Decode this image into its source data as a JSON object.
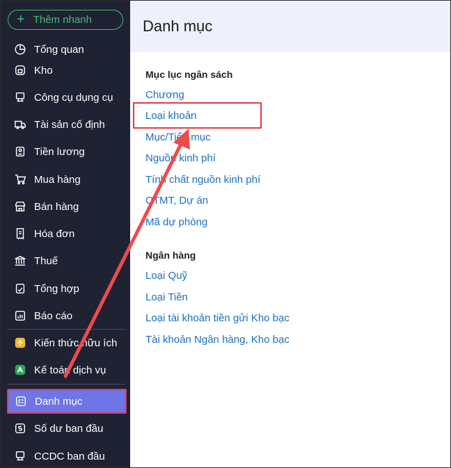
{
  "sidebar": {
    "quick_add_label": "Thêm nhanh",
    "items": [
      {
        "label": "Tổng quan",
        "icon": "pie-chart-icon"
      },
      {
        "label": "Kho",
        "icon": "warehouse-icon"
      },
      {
        "label": "Công cụ dụng cụ",
        "icon": "tools-icon"
      },
      {
        "label": "Tài sản cố định",
        "icon": "truck-icon"
      },
      {
        "label": "Tiền lương",
        "icon": "salary-icon"
      },
      {
        "label": "Mua hàng",
        "icon": "cart-icon"
      },
      {
        "label": "Bán hàng",
        "icon": "store-icon"
      },
      {
        "label": "Hóa đơn",
        "icon": "invoice-icon"
      },
      {
        "label": "Thuế",
        "icon": "bank-icon"
      },
      {
        "label": "Tổng hợp",
        "icon": "summary-icon"
      },
      {
        "label": "Báo cáo",
        "icon": "report-icon"
      },
      {
        "label": "Kiến thức hữu ích",
        "icon": "knowledge-icon"
      },
      {
        "label": "Kế toán dịch vụ",
        "icon": "accounting-service-icon"
      },
      {
        "label": "Danh mục",
        "icon": "catalog-icon"
      },
      {
        "label": "Số dư ban đầu",
        "icon": "balance-icon"
      },
      {
        "label": "CCDC ban đầu",
        "icon": "tools-initial-icon"
      }
    ]
  },
  "main": {
    "title": "Danh mục",
    "sections": [
      {
        "title": "Mục lục ngân sách",
        "links": [
          "Chương",
          "Loại khoản",
          "Mục/Tiểu mục",
          "Nguồn kinh phí",
          "Tính chất nguồn kinh phí",
          "CTMT, Dự án",
          "Mã dự phòng"
        ]
      },
      {
        "title": "Ngân hàng",
        "links": [
          "Loại Quỹ",
          "Loại Tiền",
          "Loại tài khoản tiền gửi Kho bạc",
          "Tài khoản Ngân hàng, Kho bạc"
        ]
      }
    ]
  },
  "colors": {
    "sidebar_bg": "#1f2233",
    "accent_green": "#3fbf6f",
    "active_bg": "#6f74e6",
    "annotation_red": "#e23b3b",
    "link_blue": "#1a6fc4",
    "header_bg": "#eef1fb"
  }
}
